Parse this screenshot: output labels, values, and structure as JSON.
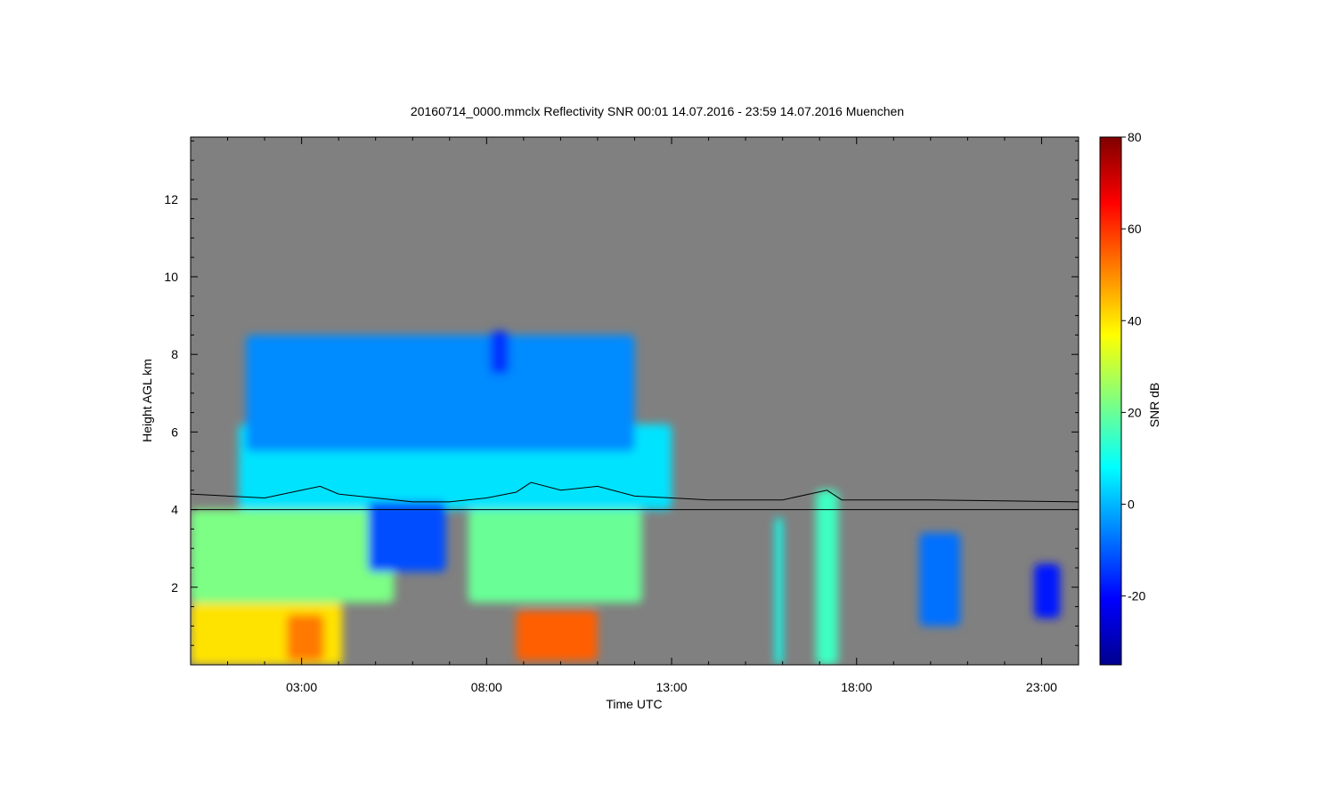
{
  "chart_data": {
    "type": "heatmap",
    "title": "20160714_0000.mmclx Reflectivity SNR   00:01 14.07.2016 - 23:59 14.07.2016 Muenchen",
    "xlabel": "Time UTC",
    "ylabel": "Height AGL km",
    "colorbar_label": "SNR dB",
    "x_range_hours": [
      0.0,
      24.0
    ],
    "y_range_km": [
      0.0,
      13.6
    ],
    "x_ticks": [
      {
        "value": 3,
        "label": "03:00"
      },
      {
        "value": 8,
        "label": "08:00"
      },
      {
        "value": 13,
        "label": "13:00"
      },
      {
        "value": 18,
        "label": "18:00"
      },
      {
        "value": 23,
        "label": "23:00"
      }
    ],
    "y_ticks": [
      {
        "value": 2,
        "label": "2"
      },
      {
        "value": 4,
        "label": "4"
      },
      {
        "value": 6,
        "label": "6"
      },
      {
        "value": 8,
        "label": "8"
      },
      {
        "value": 10,
        "label": "10"
      },
      {
        "value": 12,
        "label": "12"
      }
    ],
    "colorbar_range_db": [
      -35,
      80
    ],
    "colorbar_ticks": [
      {
        "value": 80,
        "label": "80"
      },
      {
        "value": 60,
        "label": "60"
      },
      {
        "value": 40,
        "label": "40"
      },
      {
        "value": 20,
        "label": "20"
      },
      {
        "value": 0,
        "label": "0"
      },
      {
        "value": -20,
        "label": "-20"
      }
    ],
    "colormap": "jet",
    "background_color": "#808080",
    "reference_line_km": 4.0,
    "cloud_top_line_km": [
      [
        0.0,
        4.4
      ],
      [
        1.0,
        4.35
      ],
      [
        2.0,
        4.3
      ],
      [
        3.0,
        4.5
      ],
      [
        3.5,
        4.6
      ],
      [
        4.0,
        4.4
      ],
      [
        5.0,
        4.3
      ],
      [
        6.0,
        4.2
      ],
      [
        7.0,
        4.2
      ],
      [
        8.0,
        4.3
      ],
      [
        8.8,
        4.45
      ],
      [
        9.2,
        4.7
      ],
      [
        10.0,
        4.5
      ],
      [
        11.0,
        4.6
      ],
      [
        12.0,
        4.35
      ],
      [
        13.0,
        4.3
      ],
      [
        14.0,
        4.25
      ],
      [
        16.0,
        4.25
      ],
      [
        17.2,
        4.5
      ],
      [
        17.6,
        4.25
      ],
      [
        20.0,
        4.25
      ],
      [
        24.0,
        4.2
      ]
    ],
    "echo_regions": [
      {
        "x": [
          0.0,
          4.1
        ],
        "y": [
          0.0,
          1.6
        ],
        "snr_db": 40
      },
      {
        "x": [
          2.6,
          3.6
        ],
        "y": [
          0.1,
          1.3
        ],
        "snr_db": 52
      },
      {
        "x": [
          8.8,
          11.0
        ],
        "y": [
          0.1,
          1.4
        ],
        "snr_db": 55
      },
      {
        "x": [
          0.0,
          5.5
        ],
        "y": [
          1.6,
          4.0
        ],
        "snr_db": 22
      },
      {
        "x": [
          7.5,
          12.2
        ],
        "y": [
          1.6,
          4.0
        ],
        "snr_db": 20
      },
      {
        "x": [
          1.3,
          13.0
        ],
        "y": [
          4.0,
          6.2
        ],
        "snr_db": 5
      },
      {
        "x": [
          1.5,
          12.0
        ],
        "y": [
          5.5,
          8.5
        ],
        "snr_db": -5
      },
      {
        "x": [
          8.1,
          8.6
        ],
        "y": [
          7.5,
          8.6
        ],
        "snr_db": -15
      },
      {
        "x": [
          4.8,
          6.9
        ],
        "y": [
          2.4,
          4.2
        ],
        "snr_db": -12
      },
      {
        "x": [
          15.8,
          16.0
        ],
        "y": [
          0.0,
          3.8
        ],
        "snr_db": 10
      },
      {
        "x": [
          16.9,
          17.5
        ],
        "y": [
          0.0,
          4.5
        ],
        "snr_db": 15
      },
      {
        "x": [
          19.7,
          20.8
        ],
        "y": [
          1.0,
          3.4
        ],
        "snr_db": -8
      },
      {
        "x": [
          22.8,
          23.5
        ],
        "y": [
          1.2,
          2.6
        ],
        "snr_db": -18
      }
    ]
  }
}
